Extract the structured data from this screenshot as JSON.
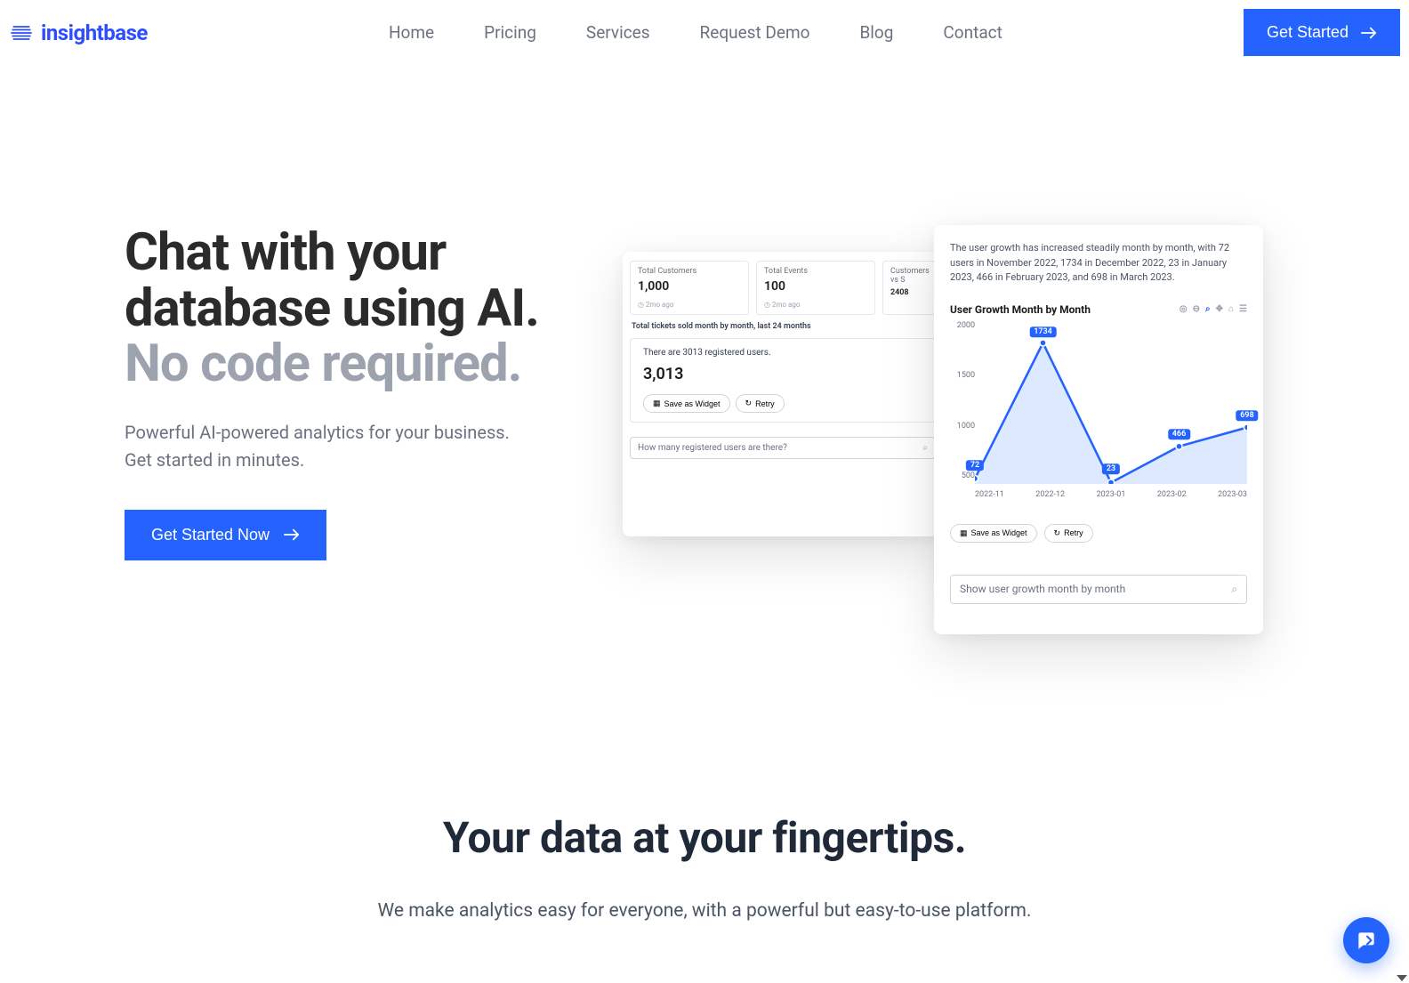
{
  "brand": "insightbase",
  "nav": [
    "Home",
    "Pricing",
    "Services",
    "Request Demo",
    "Blog",
    "Contact"
  ],
  "cta": "Get Started",
  "hero": {
    "line1": "Chat with your database using AI.",
    "line2": "No code required.",
    "sub1": "Powerful AI-powered analytics for your business.",
    "sub2": "Get started in minutes.",
    "btn": "Get Started Now"
  },
  "panelBack": {
    "cards": [
      {
        "label": "Total Customers",
        "value": "1,000",
        "ago": "2mo ago"
      },
      {
        "label": "Total Events",
        "value": "100",
        "ago": "2mo ago"
      },
      {
        "label": "Customers vs S",
        "value": "2408",
        "ago": ""
      }
    ],
    "chartTitle": "Total tickets sold month by month, last 24 months",
    "answerText": "There are 3013 registered users.",
    "answerNum": "3,013",
    "saveBtn": "Save as Widget",
    "retryBtn": "Retry",
    "prompt": "How many registered users are there?"
  },
  "panelFront": {
    "desc": "The user growth has increased steadily month by month, with 72 users in November 2022, 1734 in December 2022, 23 in January 2023, 466 in February 2023, and 698 in March 2023.",
    "chartTitle": "User Growth Month by Month",
    "saveBtn": "Save as Widget",
    "retryBtn": "Retry",
    "prompt": "Show user growth month by month"
  },
  "chart_data": {
    "type": "area",
    "title": "User Growth Month by Month",
    "xlabel": "",
    "ylabel": "",
    "ylim": [
      0,
      2000
    ],
    "y_ticks": [
      2000,
      1500,
      1000,
      500
    ],
    "categories": [
      "2022-11",
      "2022-12",
      "2023-01",
      "2023-02",
      "2023-03"
    ],
    "values": [
      72,
      1734,
      23,
      466,
      698
    ]
  },
  "section2": {
    "title": "Your data at your fingertips.",
    "sub": "We make analytics easy for everyone, with a powerful but easy-to-use platform."
  }
}
